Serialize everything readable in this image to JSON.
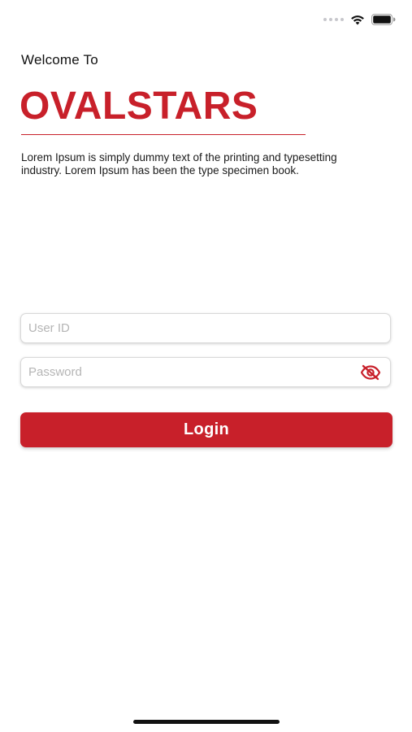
{
  "welcome": {
    "heading": "Welcome To",
    "brand": "OVALSTARS",
    "description": "Lorem Ipsum is simply dummy text of the printing and typesetting industry. Lorem Ipsum has been the type specimen book."
  },
  "form": {
    "userid_placeholder": "User ID",
    "userid_value": "",
    "password_placeholder": "Password",
    "password_value": "",
    "login_label": "Login",
    "password_toggle_icon": "eye-off-icon"
  },
  "status_bar": {
    "icons": [
      "signal-dots-icon",
      "wifi-icon",
      "battery-icon"
    ]
  },
  "colors": {
    "brand": "#c8202a",
    "field_border": "#d9d9d9",
    "placeholder": "#b5b5b5"
  }
}
